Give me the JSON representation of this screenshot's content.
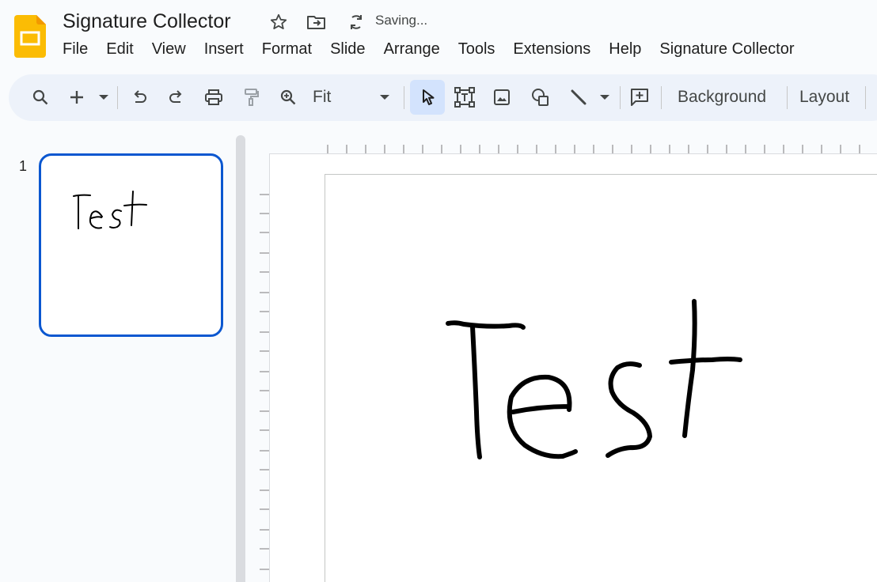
{
  "header": {
    "title": "Signature Collector",
    "status": "Saving...",
    "icons": [
      "slides-app-icon",
      "star-icon",
      "move-folder-icon",
      "sync-icon"
    ]
  },
  "menu": [
    "File",
    "Edit",
    "View",
    "Insert",
    "Format",
    "Slide",
    "Arrange",
    "Tools",
    "Extensions",
    "Help",
    "Signature Collector"
  ],
  "toolbar": {
    "zoom_value": "Fit",
    "background_label": "Background",
    "layout_label": "Layout",
    "icons": [
      "search-icon",
      "new-slide-icon",
      "undo-icon",
      "redo-icon",
      "print-icon",
      "paint-format-icon",
      "zoom-icon",
      "select-icon",
      "text-box-icon",
      "image-icon",
      "shape-icon",
      "line-icon",
      "comment-icon"
    ]
  },
  "filmstrip": {
    "slides": [
      {
        "number": "1",
        "content": "Test"
      }
    ]
  },
  "slide": {
    "handwriting": "Test"
  },
  "colors": {
    "accent": "#0b57d0",
    "app_icon": "#fbbc04",
    "toolbar_bg": "#edf2fa",
    "active_tool_bg": "#d3e3fd"
  }
}
